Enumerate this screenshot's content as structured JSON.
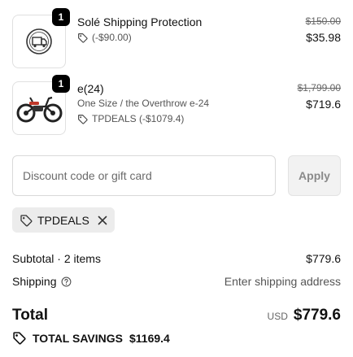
{
  "items": [
    {
      "quantity": "1",
      "title": "Solé Shipping Protection",
      "variant": "",
      "discount": "(-$90.00)",
      "original_price": "$150.00",
      "final_price": "$35.98",
      "image_icon": "shipping-protection-icon"
    },
    {
      "quantity": "1",
      "title": "e(24)",
      "variant": "One Size / the Overthrow e-24",
      "discount": "TPDEALS (-$1079.4)",
      "original_price": "$1,799.00",
      "final_price": "$719.6",
      "image_icon": "e-bike-image"
    }
  ],
  "discount_form": {
    "placeholder": "Discount code or gift card",
    "apply_label": "Apply"
  },
  "applied_code": "TPDEALS",
  "summary": {
    "subtotal_label": "Subtotal · 2 items",
    "subtotal_value": "$779.6",
    "shipping_label": "Shipping",
    "shipping_value": "Enter shipping address",
    "total_label": "Total",
    "currency": "USD",
    "total_value": "$779.6",
    "savings_label": "TOTAL SAVINGS",
    "savings_value": "$1169.4"
  }
}
